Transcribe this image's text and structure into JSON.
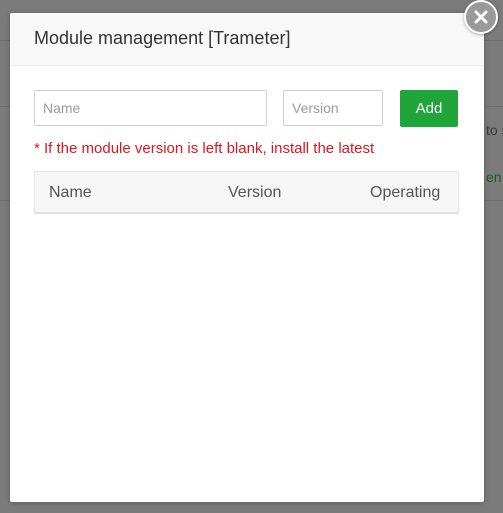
{
  "backdrop": {
    "peek_right_1": "to s",
    "peek_right_2": "en"
  },
  "modal": {
    "title": "Module management [Trameter]",
    "close_icon": "close-icon",
    "name_placeholder": "Name",
    "version_placeholder": "Version",
    "add_label": "Add",
    "hint": "* If the module version is left blank, install the latest",
    "table": {
      "columns": [
        "Name",
        "Version",
        "Operating"
      ],
      "rows": []
    }
  },
  "colors": {
    "accent": "#20a53a",
    "hint": "#e0161e",
    "overlay": "#7a7a7a"
  }
}
